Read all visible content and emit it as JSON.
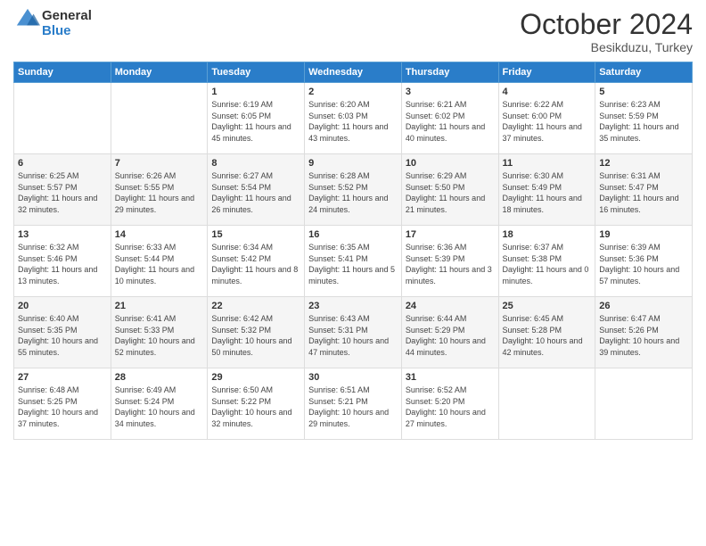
{
  "header": {
    "logo_general": "General",
    "logo_blue": "Blue",
    "month_title": "October 2024",
    "subtitle": "Besikduzu, Turkey"
  },
  "days_of_week": [
    "Sunday",
    "Monday",
    "Tuesday",
    "Wednesday",
    "Thursday",
    "Friday",
    "Saturday"
  ],
  "weeks": [
    [
      {
        "num": "",
        "sunrise": "",
        "sunset": "",
        "daylight": ""
      },
      {
        "num": "",
        "sunrise": "",
        "sunset": "",
        "daylight": ""
      },
      {
        "num": "1",
        "sunrise": "Sunrise: 6:19 AM",
        "sunset": "Sunset: 6:05 PM",
        "daylight": "Daylight: 11 hours and 45 minutes."
      },
      {
        "num": "2",
        "sunrise": "Sunrise: 6:20 AM",
        "sunset": "Sunset: 6:03 PM",
        "daylight": "Daylight: 11 hours and 43 minutes."
      },
      {
        "num": "3",
        "sunrise": "Sunrise: 6:21 AM",
        "sunset": "Sunset: 6:02 PM",
        "daylight": "Daylight: 11 hours and 40 minutes."
      },
      {
        "num": "4",
        "sunrise": "Sunrise: 6:22 AM",
        "sunset": "Sunset: 6:00 PM",
        "daylight": "Daylight: 11 hours and 37 minutes."
      },
      {
        "num": "5",
        "sunrise": "Sunrise: 6:23 AM",
        "sunset": "Sunset: 5:59 PM",
        "daylight": "Daylight: 11 hours and 35 minutes."
      }
    ],
    [
      {
        "num": "6",
        "sunrise": "Sunrise: 6:25 AM",
        "sunset": "Sunset: 5:57 PM",
        "daylight": "Daylight: 11 hours and 32 minutes."
      },
      {
        "num": "7",
        "sunrise": "Sunrise: 6:26 AM",
        "sunset": "Sunset: 5:55 PM",
        "daylight": "Daylight: 11 hours and 29 minutes."
      },
      {
        "num": "8",
        "sunrise": "Sunrise: 6:27 AM",
        "sunset": "Sunset: 5:54 PM",
        "daylight": "Daylight: 11 hours and 26 minutes."
      },
      {
        "num": "9",
        "sunrise": "Sunrise: 6:28 AM",
        "sunset": "Sunset: 5:52 PM",
        "daylight": "Daylight: 11 hours and 24 minutes."
      },
      {
        "num": "10",
        "sunrise": "Sunrise: 6:29 AM",
        "sunset": "Sunset: 5:50 PM",
        "daylight": "Daylight: 11 hours and 21 minutes."
      },
      {
        "num": "11",
        "sunrise": "Sunrise: 6:30 AM",
        "sunset": "Sunset: 5:49 PM",
        "daylight": "Daylight: 11 hours and 18 minutes."
      },
      {
        "num": "12",
        "sunrise": "Sunrise: 6:31 AM",
        "sunset": "Sunset: 5:47 PM",
        "daylight": "Daylight: 11 hours and 16 minutes."
      }
    ],
    [
      {
        "num": "13",
        "sunrise": "Sunrise: 6:32 AM",
        "sunset": "Sunset: 5:46 PM",
        "daylight": "Daylight: 11 hours and 13 minutes."
      },
      {
        "num": "14",
        "sunrise": "Sunrise: 6:33 AM",
        "sunset": "Sunset: 5:44 PM",
        "daylight": "Daylight: 11 hours and 10 minutes."
      },
      {
        "num": "15",
        "sunrise": "Sunrise: 6:34 AM",
        "sunset": "Sunset: 5:42 PM",
        "daylight": "Daylight: 11 hours and 8 minutes."
      },
      {
        "num": "16",
        "sunrise": "Sunrise: 6:35 AM",
        "sunset": "Sunset: 5:41 PM",
        "daylight": "Daylight: 11 hours and 5 minutes."
      },
      {
        "num": "17",
        "sunrise": "Sunrise: 6:36 AM",
        "sunset": "Sunset: 5:39 PM",
        "daylight": "Daylight: 11 hours and 3 minutes."
      },
      {
        "num": "18",
        "sunrise": "Sunrise: 6:37 AM",
        "sunset": "Sunset: 5:38 PM",
        "daylight": "Daylight: 11 hours and 0 minutes."
      },
      {
        "num": "19",
        "sunrise": "Sunrise: 6:39 AM",
        "sunset": "Sunset: 5:36 PM",
        "daylight": "Daylight: 10 hours and 57 minutes."
      }
    ],
    [
      {
        "num": "20",
        "sunrise": "Sunrise: 6:40 AM",
        "sunset": "Sunset: 5:35 PM",
        "daylight": "Daylight: 10 hours and 55 minutes."
      },
      {
        "num": "21",
        "sunrise": "Sunrise: 6:41 AM",
        "sunset": "Sunset: 5:33 PM",
        "daylight": "Daylight: 10 hours and 52 minutes."
      },
      {
        "num": "22",
        "sunrise": "Sunrise: 6:42 AM",
        "sunset": "Sunset: 5:32 PM",
        "daylight": "Daylight: 10 hours and 50 minutes."
      },
      {
        "num": "23",
        "sunrise": "Sunrise: 6:43 AM",
        "sunset": "Sunset: 5:31 PM",
        "daylight": "Daylight: 10 hours and 47 minutes."
      },
      {
        "num": "24",
        "sunrise": "Sunrise: 6:44 AM",
        "sunset": "Sunset: 5:29 PM",
        "daylight": "Daylight: 10 hours and 44 minutes."
      },
      {
        "num": "25",
        "sunrise": "Sunrise: 6:45 AM",
        "sunset": "Sunset: 5:28 PM",
        "daylight": "Daylight: 10 hours and 42 minutes."
      },
      {
        "num": "26",
        "sunrise": "Sunrise: 6:47 AM",
        "sunset": "Sunset: 5:26 PM",
        "daylight": "Daylight: 10 hours and 39 minutes."
      }
    ],
    [
      {
        "num": "27",
        "sunrise": "Sunrise: 6:48 AM",
        "sunset": "Sunset: 5:25 PM",
        "daylight": "Daylight: 10 hours and 37 minutes."
      },
      {
        "num": "28",
        "sunrise": "Sunrise: 6:49 AM",
        "sunset": "Sunset: 5:24 PM",
        "daylight": "Daylight: 10 hours and 34 minutes."
      },
      {
        "num": "29",
        "sunrise": "Sunrise: 6:50 AM",
        "sunset": "Sunset: 5:22 PM",
        "daylight": "Daylight: 10 hours and 32 minutes."
      },
      {
        "num": "30",
        "sunrise": "Sunrise: 6:51 AM",
        "sunset": "Sunset: 5:21 PM",
        "daylight": "Daylight: 10 hours and 29 minutes."
      },
      {
        "num": "31",
        "sunrise": "Sunrise: 6:52 AM",
        "sunset": "Sunset: 5:20 PM",
        "daylight": "Daylight: 10 hours and 27 minutes."
      },
      {
        "num": "",
        "sunrise": "",
        "sunset": "",
        "daylight": ""
      },
      {
        "num": "",
        "sunrise": "",
        "sunset": "",
        "daylight": ""
      }
    ]
  ]
}
